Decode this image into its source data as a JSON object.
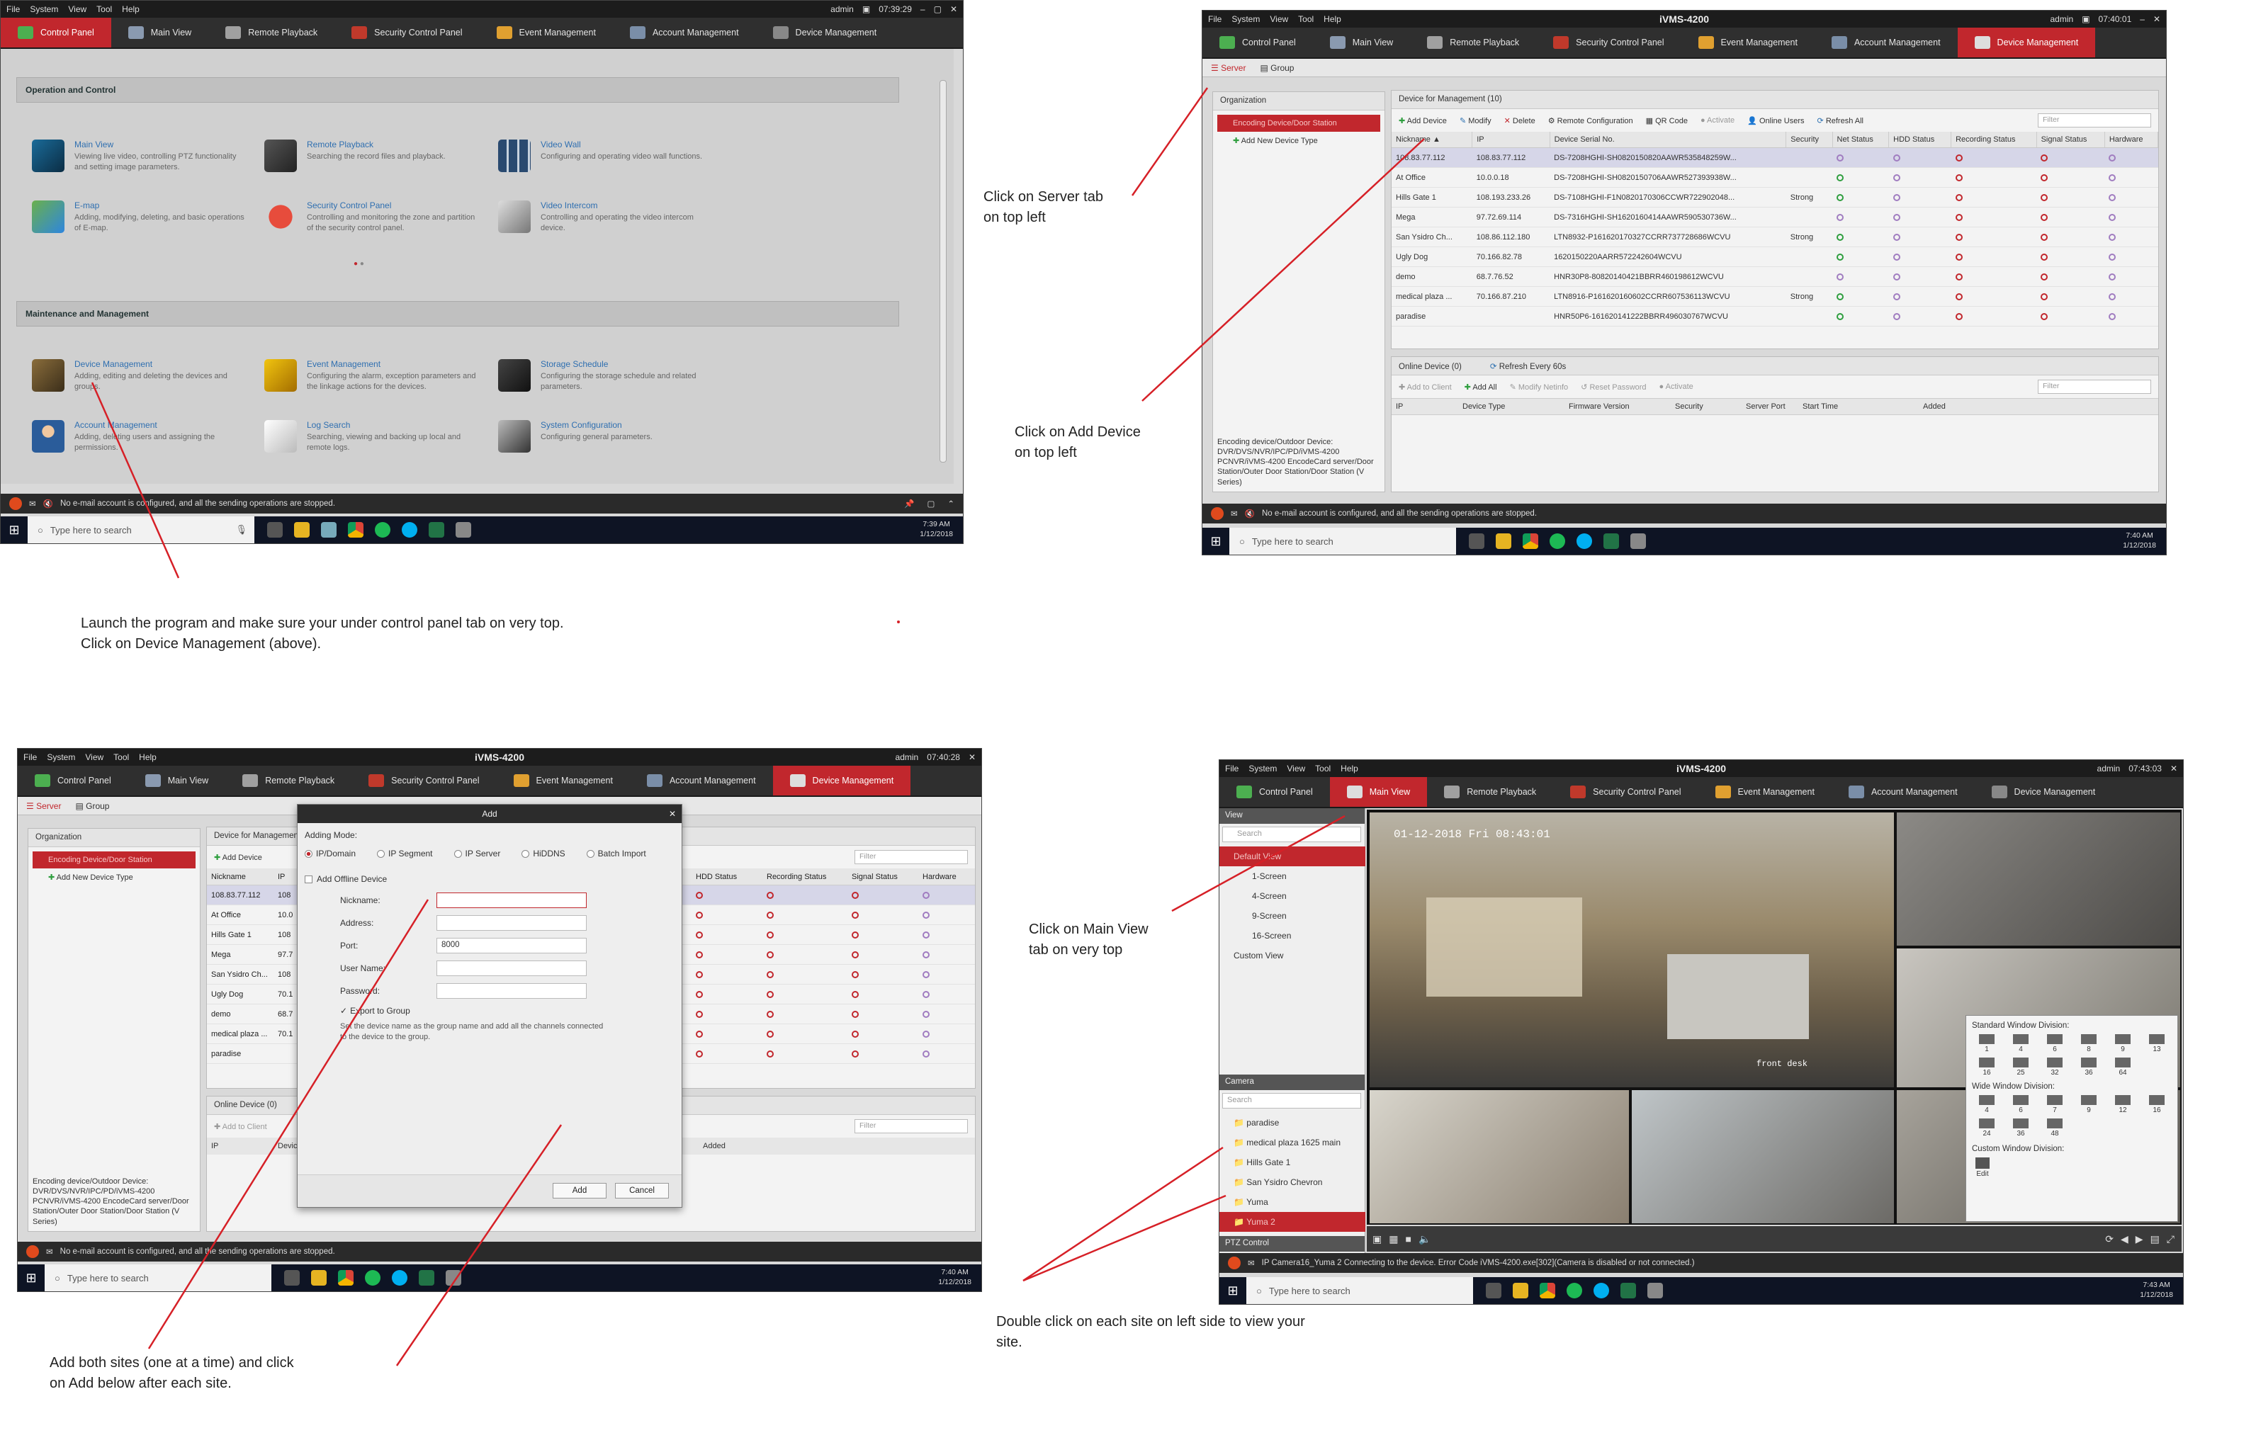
{
  "app": {
    "title": "iVMS-4200",
    "menu": [
      "File",
      "System",
      "View",
      "Tool",
      "Help"
    ],
    "user": "admin"
  },
  "tabs": [
    "Control Panel",
    "Main View",
    "Remote Playback",
    "Security Control Panel",
    "Event Management",
    "Account Management",
    "Device Management"
  ],
  "shot1": {
    "time": "07:39:29",
    "section1": "Operation and Control",
    "section2": "Maintenance and Management",
    "items": [
      {
        "title": "Main View",
        "desc": "Viewing live video, controlling PTZ functionality and setting image parameters."
      },
      {
        "title": "Remote Playback",
        "desc": "Searching the record files and playback."
      },
      {
        "title": "Video Wall",
        "desc": "Configuring and operating video wall functions."
      },
      {
        "title": "E-map",
        "desc": "Adding, modifying, deleting, and basic operations of E-map."
      },
      {
        "title": "Security Control Panel",
        "desc": "Controlling and monitoring the zone and partition of the security control panel."
      },
      {
        "title": "Video Intercom",
        "desc": "Controlling and operating the video intercom device."
      },
      {
        "title": "Device Management",
        "desc": "Adding, editing and deleting the devices and groups."
      },
      {
        "title": "Event Management",
        "desc": "Configuring the alarm, exception parameters and the linkage actions for the devices."
      },
      {
        "title": "Storage Schedule",
        "desc": "Configuring the storage schedule and related parameters."
      },
      {
        "title": "Account Management",
        "desc": "Adding, deleting users and assigning the permissions."
      },
      {
        "title": "Log Search",
        "desc": "Searching, viewing and backing up local and remote logs."
      },
      {
        "title": "System Configuration",
        "desc": "Configuring general parameters."
      }
    ],
    "status": "No e-mail account is configured, and all the sending operations are stopped.",
    "clock": [
      "7:39 AM",
      "1/12/2018"
    ]
  },
  "shot2": {
    "time": "07:40:01",
    "sub": [
      "Server",
      "Group"
    ],
    "org": "Organization",
    "org_selected": "Encoding Device/Door Station",
    "org_add": "Add New Device Type",
    "org_note": "Encoding device/Outdoor Device: DVR/DVS/NVR/IPC/PD/iVMS-4200 PCNVR/iVMS-4200 EncodeCard server/Door Station/Outer Door Station/Door Station (V Series)",
    "panel_title": "Device for Management (10)",
    "toolbar": [
      "Add Device",
      "Modify",
      "Delete",
      "Remote Configuration",
      "QR Code",
      "Activate",
      "Online Users",
      "Refresh All"
    ],
    "filter": "Filter",
    "columns": [
      "Nickname",
      "IP",
      "Device Serial No.",
      "Security",
      "Net Status",
      "HDD Status",
      "Recording Status",
      "Signal Status",
      "Hardware"
    ],
    "rows": [
      [
        "108.83.77.112",
        "108.83.77.112",
        "DS-7208HGHI-SH0820150820AAWR535848259W...",
        ""
      ],
      [
        "At Office",
        "10.0.0.18",
        "DS-7208HGHI-SH0820150706AAWR527393938W...",
        ""
      ],
      [
        "Hills Gate 1",
        "108.193.233.26",
        "DS-7108HGHI-F1N0820170306CCWR722902048...",
        "Strong"
      ],
      [
        "Mega",
        "97.72.69.114",
        "DS-7316HGHI-SH1620160414AAWR590530736W...",
        ""
      ],
      [
        "San Ysidro Ch...",
        "108.86.112.180",
        "LTN8932-P161620170327CCRR737728686WCVU",
        "Strong"
      ],
      [
        "Ugly Dog",
        "70.166.82.78",
        "1620150220AARR572242604WCVU",
        ""
      ],
      [
        "demo",
        "68.7.76.52",
        "HNR30P8-80820140421BBRR460198612WCVU",
        ""
      ],
      [
        "medical plaza ...",
        "70.166.87.210",
        "LTN8916-P161620160602CCRR607536113WCVU",
        "Strong"
      ],
      [
        "paradise",
        "",
        "HNR50P6-161620141222BBRR496030767WCVU",
        ""
      ]
    ],
    "online_title": "Online Device (0)",
    "online_refresh": "Refresh Every 60s",
    "online_toolbar": [
      "Add to Client",
      "Add All",
      "Modify Netinfo",
      "Reset Password",
      "Activate"
    ],
    "online_columns": [
      "IP",
      "Device Type",
      "Firmware Version",
      "Security",
      "Server Port",
      "Start Time",
      "Added"
    ],
    "clock": [
      "7:40 AM",
      "1/12/2018"
    ]
  },
  "shot3": {
    "time": "07:40:28",
    "panel_title": "Device for Management",
    "columns": [
      "Nickname",
      "IP"
    ],
    "right_cols": [
      "HDD Status",
      "Recording Status",
      "Signal Status",
      "Hardware"
    ],
    "nicks": [
      "108.83.77.112",
      "At Office",
      "Hills Gate 1",
      "Mega",
      "San Ysidro Ch...",
      "Ugly Dog",
      "demo",
      "medical plaza ...",
      "paradise"
    ],
    "ips": [
      "108",
      "10.0",
      "108",
      "97.7",
      "108",
      "70.1",
      "68.7",
      "70.1",
      ""
    ],
    "dialog": {
      "title": "Add",
      "adding_mode": "Adding Mode:",
      "modes": [
        "IP/Domain",
        "IP Segment",
        "IP Server",
        "HiDDNS",
        "Batch Import"
      ],
      "offline": "Add Offline Device",
      "labels": [
        "Nickname:",
        "Address:",
        "Port:",
        "User Name:",
        "Password:"
      ],
      "port": "8000",
      "export": "Export to Group",
      "note": "Set the device name as the group name and add all the channels connected to the device to the group.",
      "add": "Add",
      "cancel": "Cancel"
    },
    "clock": [
      "7:40 AM",
      "1/12/2018"
    ]
  },
  "shot4": {
    "time": "07:43:03",
    "view_title": "View",
    "search": "Search",
    "views": [
      "Default View",
      "1-Screen",
      "4-Screen",
      "9-Screen",
      "16-Screen",
      "Custom View"
    ],
    "camera_title": "Camera",
    "cameras": [
      "paradise",
      "medical plaza 1625 main",
      "Hills Gate 1",
      "San Ysidro Chevron",
      "Yuma",
      "Yuma 2"
    ],
    "ptz": "PTZ Control",
    "osd": "01-12-2018 Fri 08:43:01",
    "osd_small": "front desk",
    "std_div": "Standard Window Division:",
    "std_nums": [
      "1",
      "4",
      "6",
      "8",
      "9",
      "13",
      "16",
      "25",
      "32",
      "36",
      "64"
    ],
    "wide_div": "Wide Window Division:",
    "wide_nums": [
      "4",
      "6",
      "7",
      "9",
      "12",
      "16",
      "24",
      "36",
      "48"
    ],
    "custom_div": "Custom Window Division:",
    "edit": "Edit",
    "status": "IP Camera16_Yuma 2 Connecting to the device. Error Code iVMS-4200.exe[302](Camera is disabled or not connected.)",
    "clock": [
      "7:43 AM",
      "1/12/2018"
    ]
  },
  "taskbar": {
    "search": "Type here to search"
  },
  "captions": {
    "c1a": "Launch the program and make sure your under control panel tab on very top.",
    "c1b": "Click on Device Management (above).",
    "c2a": "Click on Server tab",
    "c2b": "on top left",
    "c3a": "Click on Add Device",
    "c3b": "on top left",
    "c4a": "Add both sites (one at a time) and click",
    "c4b": "on Add below after each site.",
    "c5a": "Click on Main View",
    "c5b": "tab on very top",
    "c6a": "Double click on each site on left side to view your",
    "c6b": "site."
  },
  "colors": {
    "accent": "#c1272d",
    "arrow": "#d62027",
    "chrome": "#2f2f2f"
  }
}
